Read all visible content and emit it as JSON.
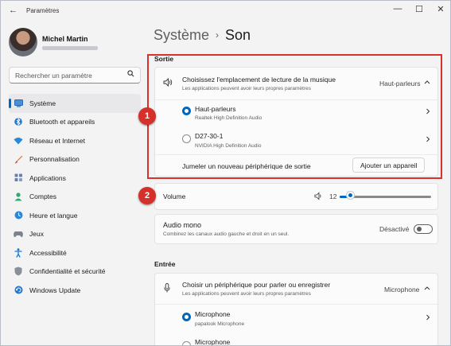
{
  "window": {
    "title": "Paramètres",
    "back_glyph": "←",
    "minimize_glyph": "—",
    "maximize_glyph": "☐",
    "close_glyph": "✕"
  },
  "profile": {
    "name": "Michel Martin"
  },
  "search": {
    "placeholder": "Rechercher un paramètre",
    "icon": "search-icon"
  },
  "sidebar": {
    "items": [
      {
        "label": "Système",
        "icon": "system-icon",
        "active": true
      },
      {
        "label": "Bluetooth et appareils",
        "icon": "bluetooth-icon"
      },
      {
        "label": "Réseau et Internet",
        "icon": "wifi-icon"
      },
      {
        "label": "Personnalisation",
        "icon": "brush-icon"
      },
      {
        "label": "Applications",
        "icon": "apps-icon"
      },
      {
        "label": "Comptes",
        "icon": "account-icon"
      },
      {
        "label": "Heure et langue",
        "icon": "globe-clock-icon"
      },
      {
        "label": "Jeux",
        "icon": "gamepad-icon"
      },
      {
        "label": "Accessibilité",
        "icon": "accessibility-icon"
      },
      {
        "label": "Confidentialité et sécurité",
        "icon": "shield-icon"
      },
      {
        "label": "Windows Update",
        "icon": "update-icon"
      }
    ]
  },
  "header": {
    "parent": "Système",
    "separator": "›",
    "current": "Son"
  },
  "output": {
    "section_label": "Sortie",
    "chooser": {
      "title": "Choisissez l'emplacement de lecture de la musique",
      "subtitle": "Les applications peuvent avoir leurs propres paramètres",
      "value": "Haut-parleurs",
      "expanded": true
    },
    "devices": [
      {
        "name": "Haut-parleurs",
        "detail": "Realtek High Definition Audio",
        "selected": true
      },
      {
        "name": "D27-30-1",
        "detail": "NVIDIA High Definition Audio",
        "selected": false
      }
    ],
    "pair": {
      "label": "Jumeler un nouveau périphérique de sortie",
      "button": "Ajouter un appareil"
    }
  },
  "volume": {
    "label": "Volume",
    "value": "12",
    "percent": 12
  },
  "mono": {
    "title": "Audio mono",
    "subtitle": "Combinez les canaux audio gauche et droit en un seul.",
    "state": "Désactivé"
  },
  "input": {
    "section_label": "Entrée",
    "chooser": {
      "title": "Choisir un périphérique pour parler ou enregistrer",
      "subtitle": "Les applications peuvent avoir leurs propres paramètres",
      "value": "Microphone"
    },
    "devices": [
      {
        "name": "Microphone",
        "detail": "papalook Microphone",
        "selected": true
      },
      {
        "name": "Microphone",
        "detail": "",
        "selected": false
      }
    ]
  },
  "annotations": {
    "marker1": "1",
    "marker2": "2",
    "color": "#d6302a"
  },
  "colors": {
    "accent": "#0067c0",
    "highlight_box": "#d9312b"
  }
}
